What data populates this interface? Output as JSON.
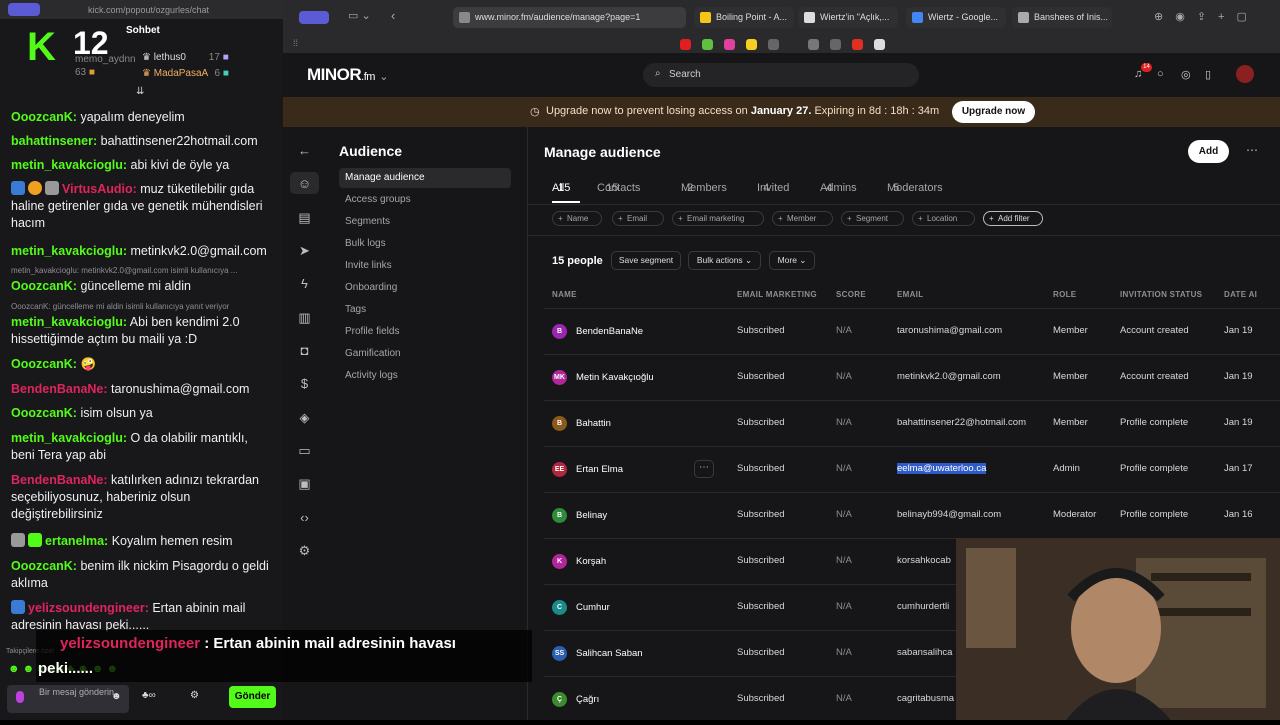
{
  "chat": {
    "url": "kick.com/popout/ozgurles/chat",
    "title": "Sohbet",
    "logo_letter": "K",
    "logo_number": "12",
    "gifters": [
      {
        "name": "memo_aydnn",
        "count": "63"
      },
      {
        "name": "lethus0",
        "count": "17"
      },
      {
        "name": "MadaPasaA",
        "count": "6"
      }
    ],
    "messages": [
      {
        "user": "OoozcanK:",
        "text": " yapalım deneyelim",
        "color": "#53fc18"
      },
      {
        "user": "bahattinsener:",
        "text": " bahattinsener22hotmail.com",
        "color": "#53fc18"
      },
      {
        "user": "metin_kavakcioglu:",
        "text": " abi kivi de öyle ya",
        "color": "#53fc18"
      },
      {
        "user": "VirtusAudio:",
        "text": " muz tüketilebilir gıda haline getirenler gıda ve genetik mühendisleri hacım",
        "color": "#e0245e"
      },
      {
        "user": "metin_kavakcioglu:",
        "text": " metinkvk2.0@gmail.com",
        "color": "#53fc18"
      },
      {
        "user": "OoozcanK:",
        "text": " güncelleme mi aldin",
        "color": "#53fc18"
      },
      {
        "user": "metin_kavakcioglu:",
        "text": " Abi ben kendimi 2.0 hissettiğimde açtım bu maili ya :D",
        "color": "#53fc18"
      },
      {
        "user": "OoozcanK:",
        "text": " 🤪",
        "color": "#53fc18"
      },
      {
        "user": "BendenBanaNe:",
        "text": " taronushima@gmail.com",
        "color": "#e0245e"
      },
      {
        "user": "OoozcanK:",
        "text": " isim olsun ya",
        "color": "#53fc18"
      },
      {
        "user": "metin_kavakcioglu:",
        "text": " O da olabilir mantıklı, beni Tera yap abi",
        "color": "#53fc18"
      },
      {
        "user": "BendenBanaNe:",
        "text": " katılırken adınızı tekrardan seçebiliyosunuz, haberiniz olsun değiştirebilirsiniz",
        "color": "#e0245e"
      },
      {
        "user": "ertanelma:",
        "text": " Koyalım hemen resim",
        "color": "#53fc18"
      },
      {
        "user": "OoozcanK:",
        "text": " benim ilk nickim Pisagordu o geldi aklıma",
        "color": "#53fc18"
      },
      {
        "user": "yelizsoundengineer:",
        "text": " Ertan abinin mail adresinin havası peki......",
        "color": "#e0245e"
      }
    ],
    "replies": [
      "metin_kavakcioglu: metinkvk2.0@gmail.com isimli kullanıcıya ...",
      "OoozcanK: güncelleme mi aldin isimli kullanıcıya yanıt veriyor"
    ],
    "overlay": {
      "user": "yelizsoundengineer",
      "line1": " : Ertan abinin mail adresinin havası",
      "line2": "peki......"
    },
    "followers_label": "Takipçilere özel",
    "input_placeholder": "Bir mesaj gönderin",
    "send_label": "Gönder"
  },
  "browser": {
    "tabs": [
      {
        "label": "www.minor.fm/audience/manage?page=1",
        "color": "#888"
      },
      {
        "label": "Boiling Point - A...",
        "color": "#f5c518"
      },
      {
        "label": "Wiertz'in \"Açlık,...",
        "color": "#ddd"
      },
      {
        "label": "Wiertz - Google...",
        "color": "#4285f4"
      },
      {
        "label": "Banshees of Inis...",
        "color": "#aaa"
      }
    ]
  },
  "app": {
    "logo": "MINOR",
    "logo_suffix": ".fm",
    "search_placeholder": "Search",
    "notif_count": "14",
    "banner": {
      "text": "Upgrade now to prevent losing access on ",
      "date": "January 27.",
      "expiry": " Expiring in 8d : 18h : 34m",
      "button": "Upgrade now"
    },
    "sidebar_title": "Audience",
    "sidebar_items": [
      "Manage audience",
      "Access groups",
      "Segments",
      "Bulk logs",
      "Invite links",
      "Onboarding",
      "Tags",
      "Profile fields",
      "Gamification",
      "Activity logs"
    ],
    "page_title": "Manage audience",
    "add_label": "Add",
    "tabs": [
      {
        "label": "All",
        "count": "15"
      },
      {
        "label": "Contacts",
        "count": "15"
      },
      {
        "label": "Members",
        "count": "2"
      },
      {
        "label": "Invited",
        "count": "4"
      },
      {
        "label": "Admins",
        "count": "4"
      },
      {
        "label": "Moderators",
        "count": "5"
      }
    ],
    "filters": [
      "Name",
      "Email",
      "Email marketing",
      "Member",
      "Segment",
      "Location",
      "Add filter"
    ],
    "people_count": "15 people",
    "save_segment": "Save segment",
    "bulk_actions": "Bulk actions ⌄",
    "more": "More ⌄",
    "columns": [
      "NAME",
      "EMAIL MARKETING",
      "SCORE",
      "EMAIL",
      "ROLE",
      "INVITATION STATUS",
      "DATE AI"
    ],
    "rows": [
      {
        "initials": "B",
        "color": "#9b27b0",
        "name": "BendenBanaNe",
        "marketing": "Subscribed",
        "score": "N/A",
        "email": "taronushima@gmail.com",
        "role": "Member",
        "status": "Account created",
        "date": "Jan 19"
      },
      {
        "initials": "MK",
        "color": "#b0279b",
        "name": "Metin Kavakçıoğlu",
        "marketing": "Subscribed",
        "score": "N/A",
        "email": "metinkvk2.0@gmail.com",
        "role": "Member",
        "status": "Account created",
        "date": "Jan 19"
      },
      {
        "initials": "B",
        "color": "#8a5a1a",
        "name": "Bahattin",
        "marketing": "Subscribed",
        "score": "N/A",
        "email": "bahattinsener22@hotmail.com",
        "role": "Member",
        "status": "Profile complete",
        "date": "Jan 19"
      },
      {
        "initials": "EE",
        "color": "#b02740",
        "name": "Ertan Elma",
        "marketing": "Subscribed",
        "score": "N/A",
        "email": "eelma@uwaterloo.ca",
        "role": "Admin",
        "status": "Profile complete",
        "date": "Jan 17"
      },
      {
        "initials": "B",
        "color": "#2e8b3a",
        "name": "Belinay",
        "marketing": "Subscribed",
        "score": "N/A",
        "email": "belinayb994@gmail.com",
        "role": "Moderator",
        "status": "Profile complete",
        "date": "Jan 16"
      },
      {
        "initials": "K",
        "color": "#b0279b",
        "name": "Korşah",
        "marketing": "Subscribed",
        "score": "N/A",
        "email": "korsahkocab",
        "role": "",
        "status": "",
        "date": ""
      },
      {
        "initials": "C",
        "color": "#1a8a8a",
        "name": "Cumhur",
        "marketing": "Subscribed",
        "score": "N/A",
        "email": "cumhurdertli",
        "role": "",
        "status": "",
        "date": ""
      },
      {
        "initials": "SS",
        "color": "#2b5fb0",
        "name": "Salihcan Saban",
        "marketing": "Subscribed",
        "score": "N/A",
        "email": "sabansalihca",
        "role": "",
        "status": "",
        "date": ""
      },
      {
        "initials": "Ç",
        "color": "#3a8a2e",
        "name": "Çağrı",
        "marketing": "Subscribed",
        "score": "N/A",
        "email": "cagritabusma",
        "role": "",
        "status": "",
        "date": ""
      }
    ]
  }
}
